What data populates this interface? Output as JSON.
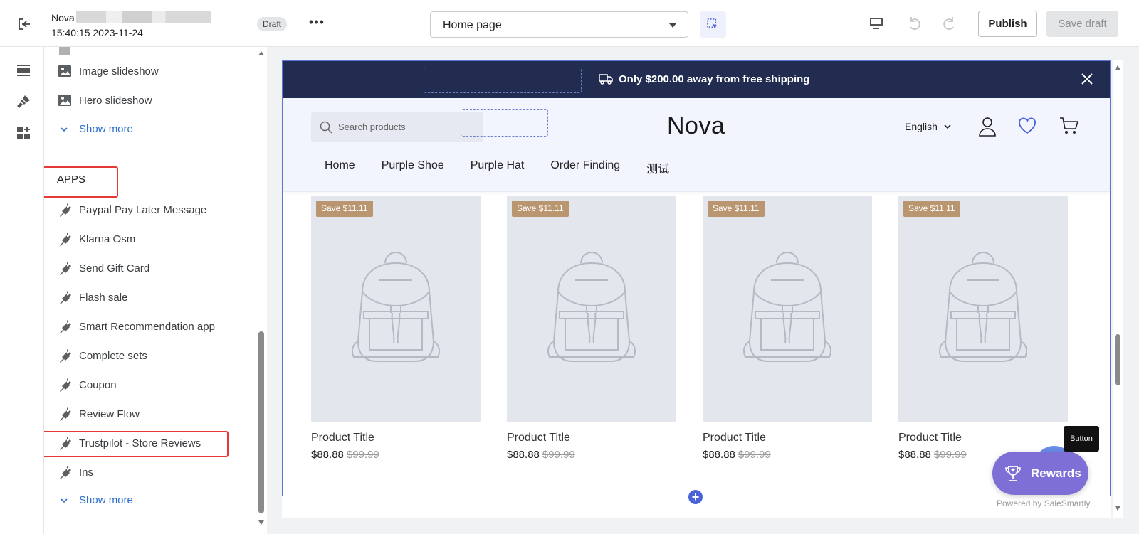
{
  "topbar": {
    "theme_name": "Nova",
    "theme_date": "15:40:15 2023-11-24",
    "status": "Draft",
    "more_label": "•••",
    "page_select": "Home page",
    "publish_label": "Publish",
    "save_draft_label": "Save draft"
  },
  "sidebar": {
    "top_items": [
      {
        "label": "Image slideshow",
        "icon": "image-icon"
      },
      {
        "label": "Hero slideshow",
        "icon": "image-icon"
      }
    ],
    "show_more_1": "Show more",
    "apps_title": "APPS",
    "apps": [
      {
        "label": "Paypal Pay Later Message",
        "icon": "plug-icon"
      },
      {
        "label": "Klarna Osm",
        "icon": "plug-icon"
      },
      {
        "label": "Send Gift Card",
        "icon": "plug-icon"
      },
      {
        "label": "Flash sale",
        "icon": "plug-icon"
      },
      {
        "label": "Smart Recommendation app",
        "icon": "plug-icon"
      },
      {
        "label": "Complete sets",
        "icon": "plug-icon"
      },
      {
        "label": "Coupon",
        "icon": "plug-icon"
      },
      {
        "label": "Review Flow",
        "icon": "plug-icon"
      },
      {
        "label": "Trustpilot - Store Reviews",
        "icon": "plug-icon"
      },
      {
        "label": "Ins",
        "icon": "plug-icon"
      }
    ],
    "show_more_2": "Show more"
  },
  "preview": {
    "announcement": "Only $200.00 away from free shipping",
    "search_placeholder": "Search products",
    "logo": "Nova",
    "language": "English",
    "nav": [
      "Home",
      "Purple Shoe",
      "Purple Hat",
      "Order Finding",
      "测试"
    ],
    "products": [
      {
        "tag": "Save $11.11",
        "title": "Product Title",
        "price": "$88.88",
        "compare_price": "$99.99"
      },
      {
        "tag": "Save $11.11",
        "title": "Product Title",
        "price": "$88.88",
        "compare_price": "$99.99"
      },
      {
        "tag": "Save $11.11",
        "title": "Product Title",
        "price": "$88.88",
        "compare_price": "$99.99"
      },
      {
        "tag": "Save $11.11",
        "title": "Product Title",
        "price": "$88.88",
        "compare_price": "$99.99"
      }
    ],
    "add_section": "+",
    "powered_by": "Powered by SaleSmartly",
    "tooltip": "Button",
    "rewards_label": "Rewards"
  },
  "colors": {
    "accent": "#2c6ecb",
    "announcement_bg": "#222c50",
    "tag_bg": "#b99570",
    "highlight": "#e53935",
    "rewards_bg": "#7d6fd6"
  }
}
